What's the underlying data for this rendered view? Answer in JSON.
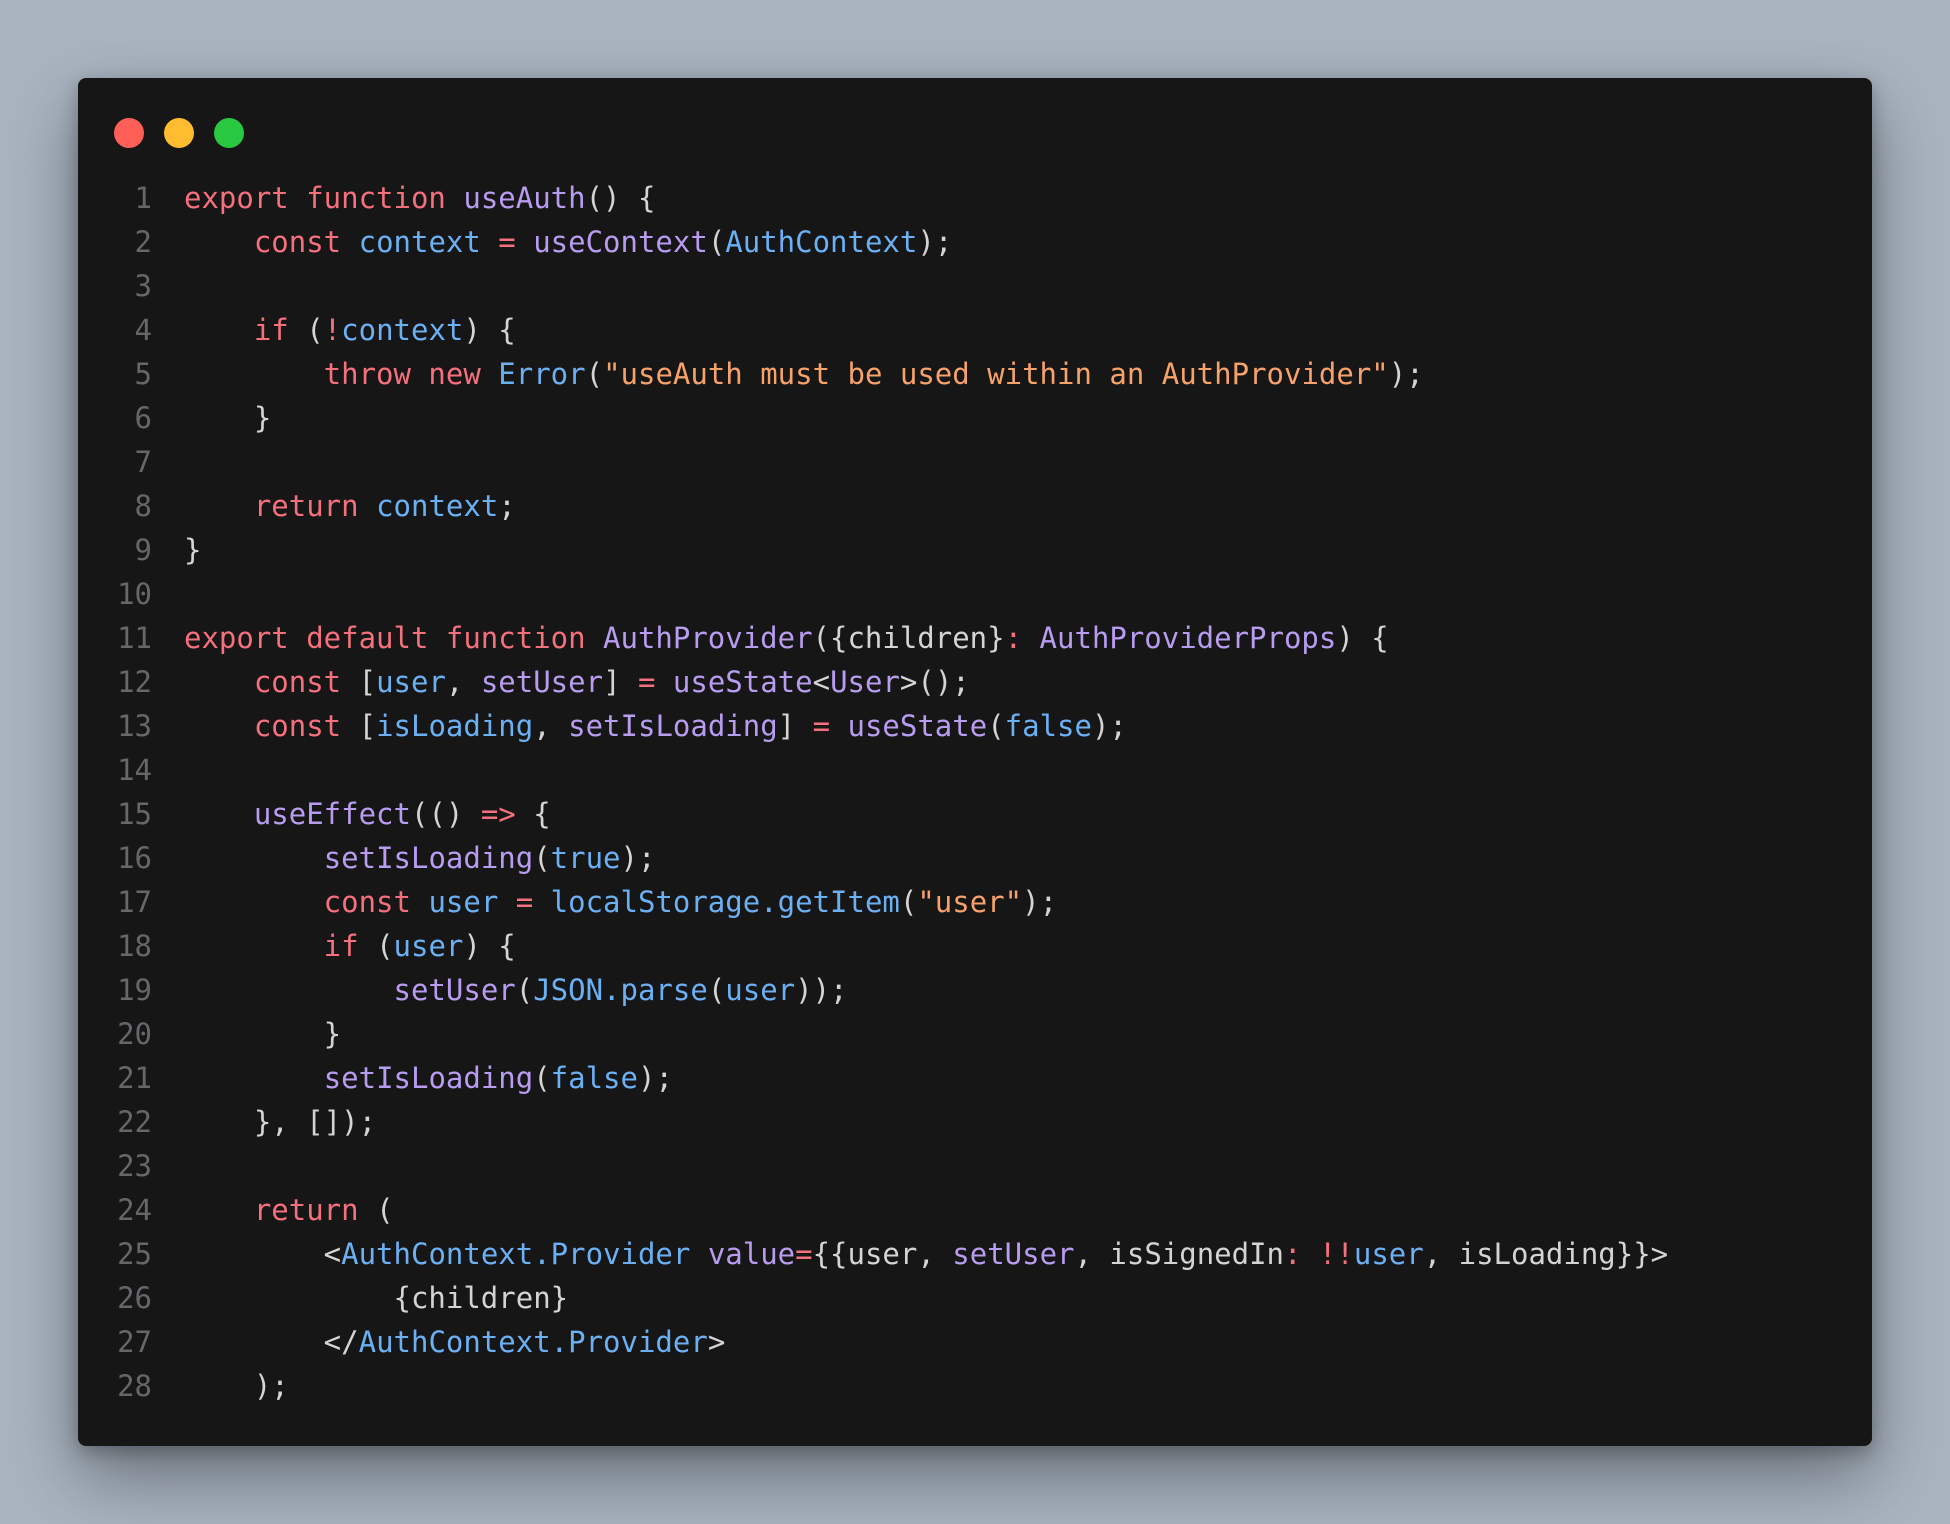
{
  "colors": {
    "background": "#a9b4c0",
    "editor": "#161616",
    "line_number": "#66666b",
    "default": "#d4d4d4",
    "keyword": "#f4707c",
    "function": "#b89cf0",
    "variable": "#6cb0f4",
    "string": "#f6a26a"
  },
  "window_controls": [
    {
      "name": "close",
      "color": "#ff5f57"
    },
    {
      "name": "minimize",
      "color": "#febc2e"
    },
    {
      "name": "maximize",
      "color": "#28c840"
    }
  ],
  "lines": [
    {
      "num": "1",
      "tokens": [
        [
          "export function ",
          "keyword"
        ],
        [
          "useAuth",
          "function"
        ],
        [
          "() {",
          "default"
        ]
      ]
    },
    {
      "num": "2",
      "tokens": [
        [
          "    const ",
          "keyword"
        ],
        [
          "context",
          "variable"
        ],
        [
          " = ",
          "keyword"
        ],
        [
          "useContext",
          "function"
        ],
        [
          "(",
          "default"
        ],
        [
          "AuthContext",
          "variable"
        ],
        [
          ");",
          "default"
        ]
      ]
    },
    {
      "num": "3",
      "tokens": []
    },
    {
      "num": "4",
      "tokens": [
        [
          "    if ",
          "keyword"
        ],
        [
          "(",
          "default"
        ],
        [
          "!",
          "keyword"
        ],
        [
          "context",
          "variable"
        ],
        [
          ") {",
          "default"
        ]
      ]
    },
    {
      "num": "5",
      "tokens": [
        [
          "        throw new ",
          "keyword"
        ],
        [
          "Error",
          "variable"
        ],
        [
          "(",
          "default"
        ],
        [
          "\"useAuth must be used within an AuthProvider\"",
          "string"
        ],
        [
          ");",
          "default"
        ]
      ]
    },
    {
      "num": "6",
      "tokens": [
        [
          "    }",
          "default"
        ]
      ]
    },
    {
      "num": "7",
      "tokens": []
    },
    {
      "num": "8",
      "tokens": [
        [
          "    return ",
          "keyword"
        ],
        [
          "context",
          "variable"
        ],
        [
          ";",
          "default"
        ]
      ]
    },
    {
      "num": "9",
      "tokens": [
        [
          "}",
          "default"
        ]
      ]
    },
    {
      "num": "10",
      "tokens": []
    },
    {
      "num": "11",
      "tokens": [
        [
          "export default function ",
          "keyword"
        ],
        [
          "AuthProvider",
          "function"
        ],
        [
          "({children}",
          "default"
        ],
        [
          ": ",
          "keyword"
        ],
        [
          "AuthProviderProps",
          "function"
        ],
        [
          ") {",
          "default"
        ]
      ]
    },
    {
      "num": "12",
      "tokens": [
        [
          "    const ",
          "keyword"
        ],
        [
          "[",
          "default"
        ],
        [
          "user",
          "variable"
        ],
        [
          ", ",
          "default"
        ],
        [
          "setUser",
          "function"
        ],
        [
          "] ",
          "default"
        ],
        [
          "= ",
          "keyword"
        ],
        [
          "useState",
          "function"
        ],
        [
          "<",
          "default"
        ],
        [
          "User",
          "function"
        ],
        [
          ">();",
          "default"
        ]
      ]
    },
    {
      "num": "13",
      "tokens": [
        [
          "    const ",
          "keyword"
        ],
        [
          "[",
          "default"
        ],
        [
          "isLoading",
          "variable"
        ],
        [
          ", ",
          "default"
        ],
        [
          "setIsLoading",
          "function"
        ],
        [
          "] ",
          "default"
        ],
        [
          "= ",
          "keyword"
        ],
        [
          "useState",
          "function"
        ],
        [
          "(",
          "default"
        ],
        [
          "false",
          "variable"
        ],
        [
          ");",
          "default"
        ]
      ]
    },
    {
      "num": "14",
      "tokens": []
    },
    {
      "num": "15",
      "tokens": [
        [
          "    ",
          "default"
        ],
        [
          "useEffect",
          "function"
        ],
        [
          "(() ",
          "default"
        ],
        [
          "=>",
          "keyword"
        ],
        [
          " {",
          "default"
        ]
      ]
    },
    {
      "num": "16",
      "tokens": [
        [
          "        ",
          "default"
        ],
        [
          "setIsLoading",
          "function"
        ],
        [
          "(",
          "default"
        ],
        [
          "true",
          "variable"
        ],
        [
          ");",
          "default"
        ]
      ]
    },
    {
      "num": "17",
      "tokens": [
        [
          "        const ",
          "keyword"
        ],
        [
          "user",
          "variable"
        ],
        [
          " = ",
          "keyword"
        ],
        [
          "localStorage.getItem",
          "variable"
        ],
        [
          "(",
          "default"
        ],
        [
          "\"user\"",
          "string"
        ],
        [
          ");",
          "default"
        ]
      ]
    },
    {
      "num": "18",
      "tokens": [
        [
          "        if ",
          "keyword"
        ],
        [
          "(",
          "default"
        ],
        [
          "user",
          "variable"
        ],
        [
          ") {",
          "default"
        ]
      ]
    },
    {
      "num": "19",
      "tokens": [
        [
          "            ",
          "default"
        ],
        [
          "setUser",
          "function"
        ],
        [
          "(",
          "default"
        ],
        [
          "JSON.parse",
          "variable"
        ],
        [
          "(",
          "default"
        ],
        [
          "user",
          "variable"
        ],
        [
          "));",
          "default"
        ]
      ]
    },
    {
      "num": "20",
      "tokens": [
        [
          "        }",
          "default"
        ]
      ]
    },
    {
      "num": "21",
      "tokens": [
        [
          "        ",
          "default"
        ],
        [
          "setIsLoading",
          "function"
        ],
        [
          "(",
          "default"
        ],
        [
          "false",
          "variable"
        ],
        [
          ");",
          "default"
        ]
      ]
    },
    {
      "num": "22",
      "tokens": [
        [
          "    }, []);",
          "default"
        ]
      ]
    },
    {
      "num": "23",
      "tokens": []
    },
    {
      "num": "24",
      "tokens": [
        [
          "    return ",
          "keyword"
        ],
        [
          "(",
          "default"
        ]
      ]
    },
    {
      "num": "25",
      "tokens": [
        [
          "        <",
          "default"
        ],
        [
          "AuthContext.Provider",
          "variable"
        ],
        [
          " ",
          "default"
        ],
        [
          "value",
          "function"
        ],
        [
          "=",
          "keyword"
        ],
        [
          "{{user, ",
          "default"
        ],
        [
          "setUser",
          "function"
        ],
        [
          ", isSignedIn",
          "default"
        ],
        [
          ": !!",
          "keyword"
        ],
        [
          "user",
          "variable"
        ],
        [
          ", isLoading}}>",
          "default"
        ]
      ]
    },
    {
      "num": "26",
      "tokens": [
        [
          "            {children}",
          "default"
        ]
      ]
    },
    {
      "num": "27",
      "tokens": [
        [
          "        </",
          "default"
        ],
        [
          "AuthContext.Provider",
          "variable"
        ],
        [
          ">",
          "default"
        ]
      ]
    },
    {
      "num": "28",
      "tokens": [
        [
          "    );",
          "default"
        ]
      ]
    }
  ]
}
